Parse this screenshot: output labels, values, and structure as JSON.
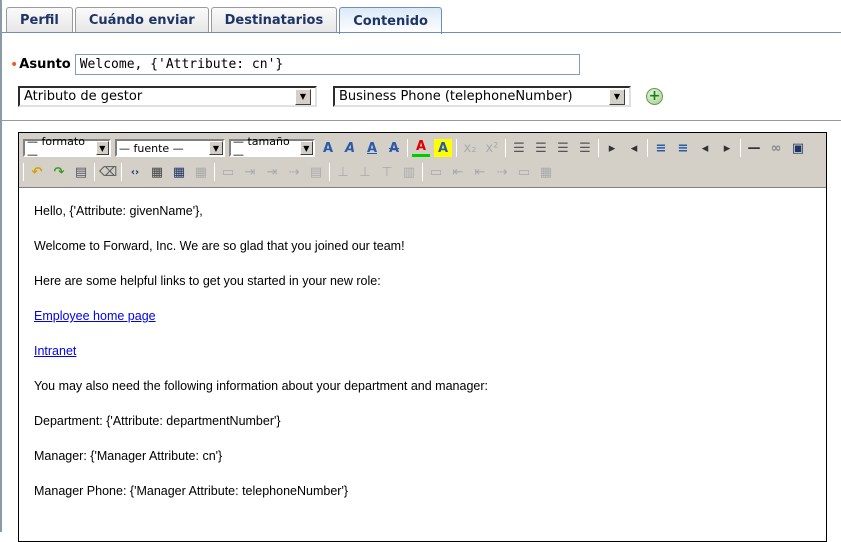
{
  "tabs": [
    {
      "label": "Perfil"
    },
    {
      "label": "Cuándo enviar"
    },
    {
      "label": "Destinatarios"
    },
    {
      "label": "Contenido",
      "active": true
    }
  ],
  "subject": {
    "label": "Asunto",
    "value": "Welcome, {'Attribute: cn'}"
  },
  "selects": {
    "attribute_type": "Atributo de gestor",
    "attribute": "Business Phone (telephoneNumber)"
  },
  "toolbar": {
    "format": "— formato —",
    "font": "— fuente —",
    "size": "— tamaño —"
  },
  "body": {
    "greeting": "Hello, {'Attribute: givenName'},",
    "welcome": "Welcome to Forward, Inc. We are so glad that you joined our team!",
    "links_intro": "Here are some helpful links to get you started in your new role:",
    "link1": "Employee home page",
    "link2": "Intranet",
    "info_intro": "You may also need the following information about your department and manager:",
    "department": "Department: {'Attribute: departmentNumber'}",
    "manager": "Manager: {'Manager Attribute: cn'}",
    "manager_phone": "Manager Phone: {'Manager Attribute: telephoneNumber'}"
  }
}
